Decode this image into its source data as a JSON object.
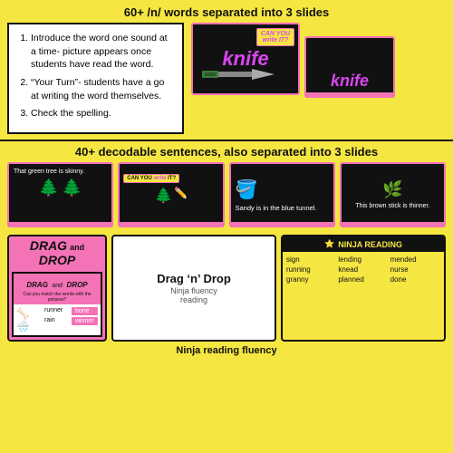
{
  "sections": {
    "header1": {
      "text": "60+ /n/ words separated into 3 slides"
    },
    "header2": {
      "text": "40+ decodable sentences, also separated into 3 slides"
    }
  },
  "instructions": {
    "items": [
      "Introduce the word one sound at a time- picture appears once students have read the word.",
      "“Your Turn”- students have a go at writing the word themselves.",
      "Check the spelling."
    ]
  },
  "slides": {
    "knife1": {
      "word": "knife",
      "badge": "CAN YOU",
      "badge_italic": "write",
      "badge_suffix": "IT?"
    },
    "knife2": {
      "word": "knife"
    },
    "sentence1": {
      "text": "That green tree is skinny."
    },
    "sentence2": {
      "text": "Sandy is in the blue tunnel."
    },
    "sentence3": {
      "text": "This brown stick is thinner."
    }
  },
  "widgets": {
    "drag_drop_big": {
      "title1": "DRAG",
      "and": "and",
      "title2": "DROP"
    },
    "drag_drop_nested": {
      "title": "DRAG",
      "and": "and",
      "title2": "DROP",
      "subtitle": "Can you match the words with the pictures?",
      "words": [
        {
          "label": "runner",
          "match": "bone"
        },
        {
          "label": "rain",
          "match": "winner"
        }
      ]
    },
    "drag_n_drop": {
      "line1": "Drag ‘n’ Drop",
      "line2": ""
    },
    "ninja_reading": {
      "header": "NINJA READING",
      "words": [
        "sign",
        "lending",
        "mended",
        "running",
        "knead",
        "nurse",
        "granny",
        "planned",
        "done"
      ]
    },
    "ninja_fluency": {
      "label": "Ninja fluency\nreading"
    }
  }
}
